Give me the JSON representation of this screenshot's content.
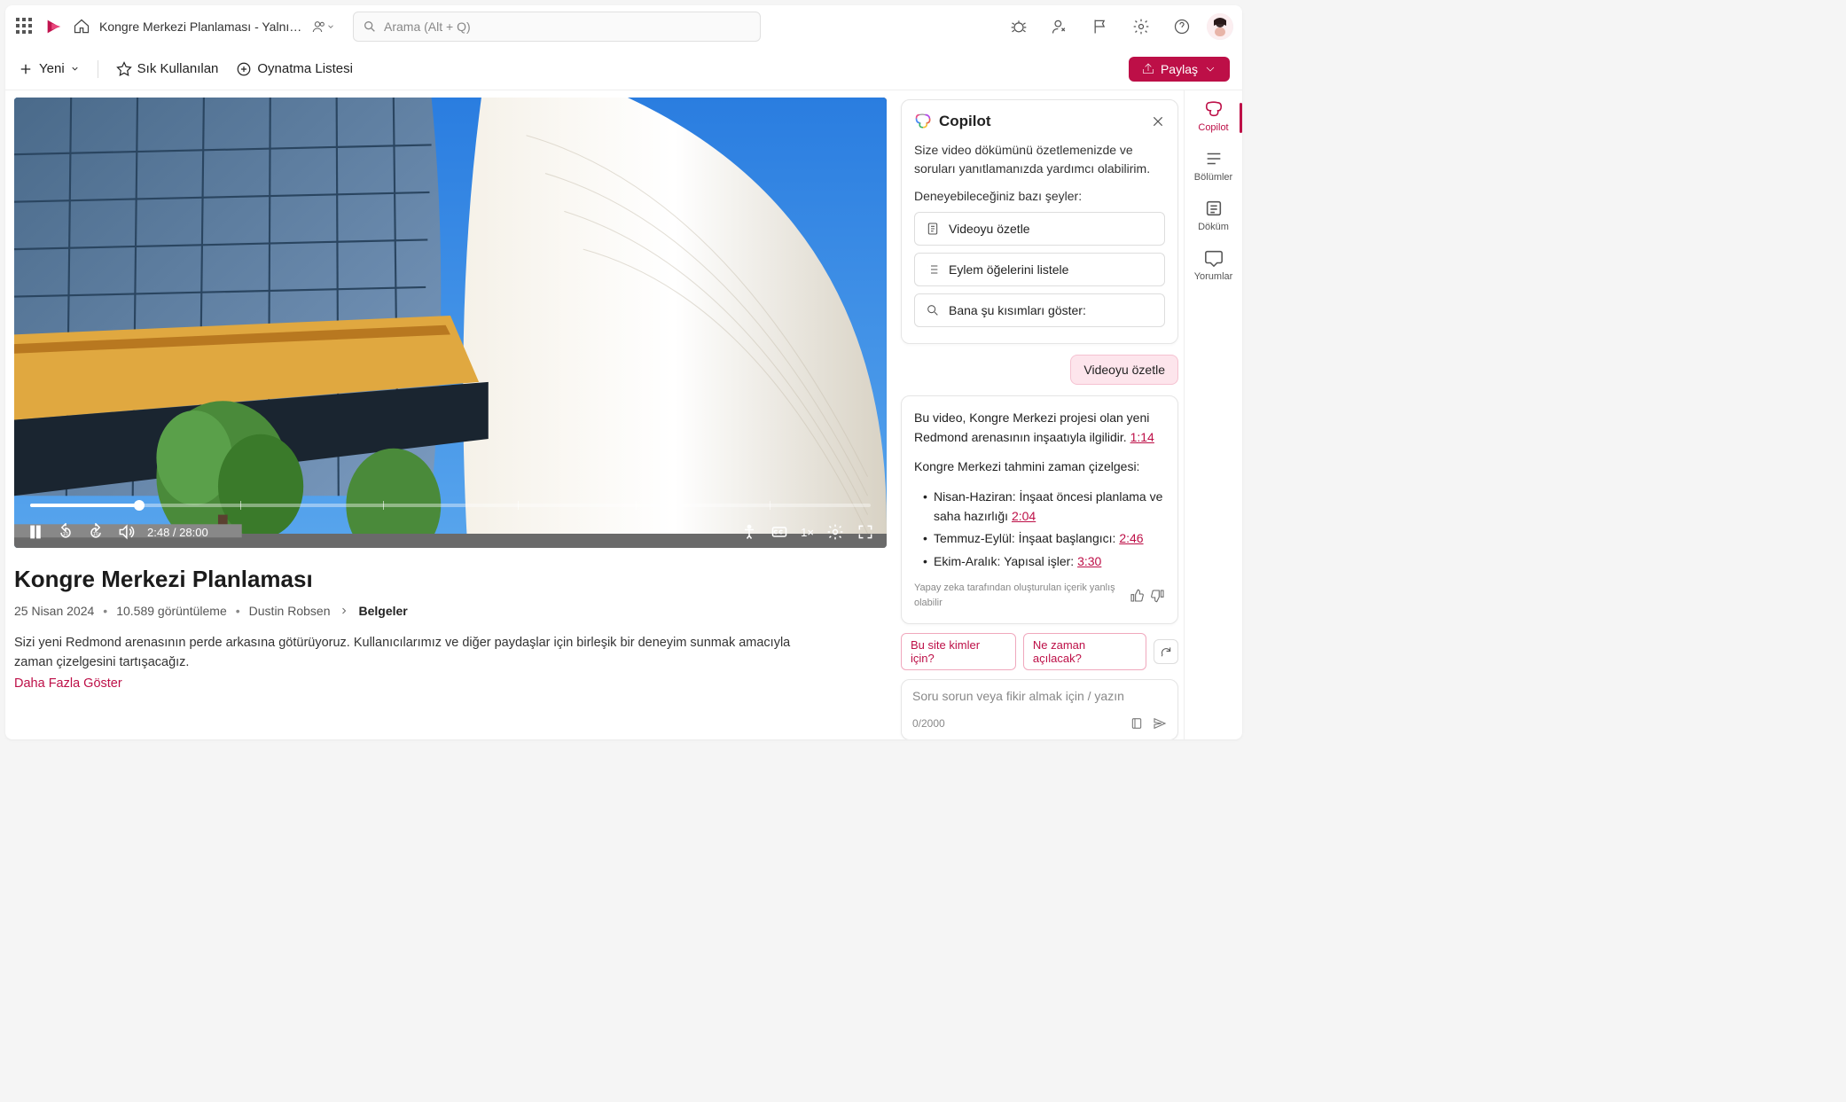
{
  "header": {
    "breadcrumb": "Kongre Merkezi Planlaması - Yalnız...",
    "search_placeholder": "Arama (Alt + Q)"
  },
  "toolbar": {
    "new": "Yeni",
    "favorites": "Sık Kullanılan",
    "playlist": "Oynatma Listesi",
    "share": "Paylaş"
  },
  "video": {
    "current_time": "2:48",
    "total_time": "28:00",
    "speed": "1×",
    "title": "Kongre Merkezi Planlaması",
    "date": "25 Nisan 2024",
    "views": "10.589 görüntüleme",
    "author": "Dustin Robsen",
    "crumb_end": "Belgeler",
    "description": "Sizi yeni Redmond arenasının perde arkasına götürüyoruz. Kullanıcılarımız ve diğer paydaşlar için birleşik bir deneyim sunmak amacıyla zaman çizelgesini tartışacağız.",
    "show_more": "Daha Fazla Göster"
  },
  "copilot": {
    "title": "Copilot",
    "intro": "Size video dökümünü özetlemenizde ve soruları yanıtlamanızda yardımcı olabilirim.",
    "try_label": "Deneyebileceğiniz bazı şeyler:",
    "suggestions": {
      "summarize": "Videoyu özetle",
      "actions": "Eylem öğelerini listele",
      "show_parts": "Bana şu kısımları göster:"
    },
    "user_msg": "Videoyu özetle",
    "answer": {
      "para": "Bu video, Kongre Merkezi projesi olan yeni Redmond arenasının inşaatıyla ilgilidir.",
      "ts1": "1:14",
      "timeline_head": "Kongre Merkezi tahmini zaman çizelgesi:",
      "b1_text": "Nisan-Haziran: İnşaat öncesi planlama ve saha hazırlığı",
      "b1_ts": "2:04",
      "b2_text": "Temmuz-Eylül: İnşaat başlangıcı:",
      "b2_ts": "2:46",
      "b3_text": "Ekim-Aralık: Yapısal işler:",
      "b3_ts": "3:30"
    },
    "disclaimer": "Yapay zeka tarafından oluşturulan içerik yanlış olabilir",
    "followups": {
      "q1": "Bu site kimler için?",
      "q2": "Ne zaman açılacak?"
    },
    "input_placeholder": "Soru sorun veya fikir almak için / yazın",
    "counter": "0/2000"
  },
  "rail": {
    "copilot": "Copilot",
    "chapters": "Bölümler",
    "transcript": "Döküm",
    "comments": "Yorumlar"
  }
}
